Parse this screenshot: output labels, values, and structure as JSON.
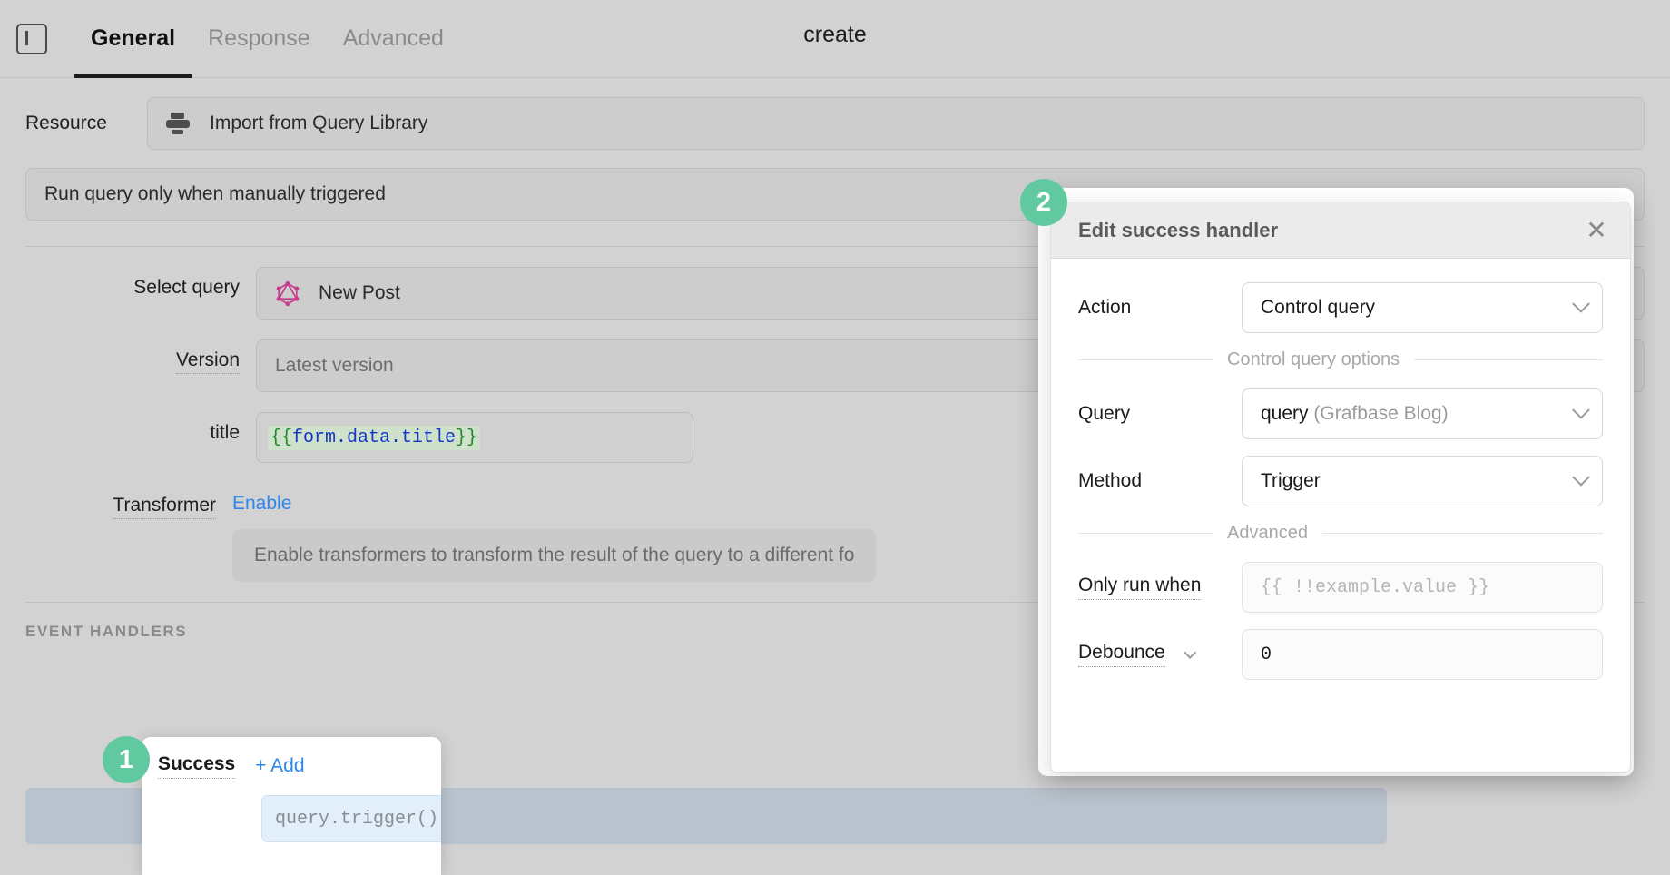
{
  "header": {
    "panel_toggle_icon": "sidebar-panel-icon",
    "tabs": [
      {
        "label": "General",
        "active": true
      },
      {
        "label": "Response",
        "active": false
      },
      {
        "label": "Advanced",
        "active": false
      }
    ],
    "query_name": "create"
  },
  "form": {
    "resource": {
      "label": "Resource",
      "icon": "database-icon",
      "value": "Import from Query Library"
    },
    "run_mode": {
      "value": "Run query only when manually triggered"
    },
    "select_query": {
      "label": "Select query",
      "icon": "graphql-icon",
      "value": "New Post"
    },
    "version": {
      "label": "Version",
      "value": "Latest version"
    },
    "title_field": {
      "label": "title",
      "value_open": "{{",
      "value_inner": "form.data.title",
      "value_close": "}}"
    },
    "transformer": {
      "label": "Transformer",
      "enable_label": "Enable",
      "description": "Enable transformers to transform the result of the query to a different fo"
    },
    "event_handlers_title": "EVENT HANDLERS",
    "success_handler": {
      "label": "Success",
      "add_label": "+ Add",
      "code": "query.trigger()"
    }
  },
  "badges": {
    "one": "1",
    "two": "2"
  },
  "modal": {
    "title": "Edit success handler",
    "close_icon": "close-icon",
    "action": {
      "label": "Action",
      "value": "Control query"
    },
    "control_query_options_separator": "Control query options",
    "query": {
      "label": "Query",
      "value": "query ",
      "value_gray": "(Grafbase Blog)"
    },
    "method": {
      "label": "Method",
      "value": "Trigger"
    },
    "advanced_separator": "Advanced",
    "only_run_when": {
      "label": "Only run when",
      "placeholder": "{{ !!example.value }}"
    },
    "debounce": {
      "label": "Debounce",
      "value": "0"
    }
  },
  "colors": {
    "accent_blue": "#2f87e8",
    "badge_green": "#61c9a0",
    "graphql_pink": "#c73c8e",
    "code_green": "#1f8b2c",
    "code_blue": "#1438c4"
  }
}
